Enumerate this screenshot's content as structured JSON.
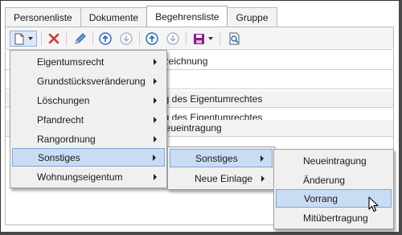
{
  "tabs": [
    {
      "label": "Personenliste",
      "active": false
    },
    {
      "label": "Dokumente",
      "active": false
    },
    {
      "label": "Begehrensliste",
      "active": true
    },
    {
      "label": "Gruppe",
      "active": false
    }
  ],
  "toolbar": {
    "new_icon": "new-document-icon",
    "delete_icon": "delete-x-icon",
    "edit_icon": "pencil-icon",
    "colors": {
      "accent": "#2f6fbf",
      "delete": "#d9332b",
      "save": "#8a1f8a"
    }
  },
  "rows": [
    {
      "text": "ezeichnung"
    },
    {
      "text": ""
    },
    {
      "text": "ng des Eigentumrechtes"
    },
    {
      "text": "ng des Eigentumrechtes"
    },
    {
      "text": "Neueintragung"
    },
    {
      "text": ""
    }
  ],
  "menu1": {
    "items": [
      {
        "label": "Eigentumsrecht",
        "submenu": true
      },
      {
        "label": "Grundstücksveränderung",
        "submenu": true
      },
      {
        "label": "Löschungen",
        "submenu": true
      },
      {
        "label": "Pfandrecht",
        "submenu": true
      },
      {
        "label": "Rangordnung",
        "submenu": true
      },
      {
        "label": "Sonstiges",
        "submenu": true,
        "selected": true
      },
      {
        "label": "Wohnungseigentum",
        "submenu": true
      }
    ]
  },
  "menu2": {
    "items": [
      {
        "label": "Sonstiges",
        "submenu": true,
        "selected": true
      },
      {
        "label": "Neue Einlage",
        "submenu": true
      }
    ]
  },
  "menu3": {
    "items": [
      {
        "label": "Neueintragung"
      },
      {
        "label": "Änderung"
      },
      {
        "label": "Vorrang",
        "selected": true
      },
      {
        "label": "Mitübertragung"
      }
    ]
  }
}
